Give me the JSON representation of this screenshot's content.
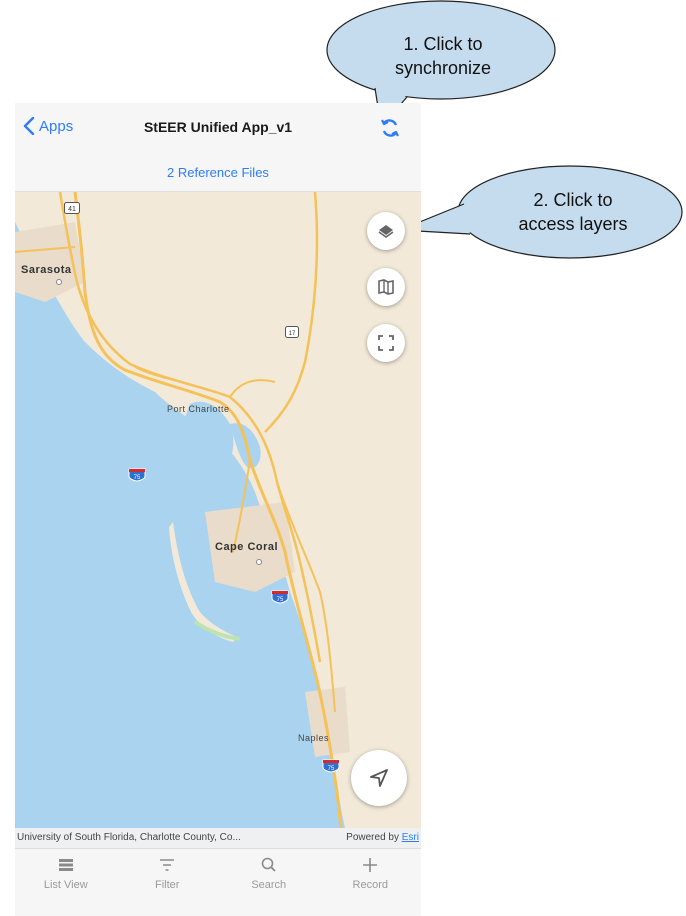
{
  "navbar": {
    "back_label": "Apps",
    "title": "StEER Unified App_v1"
  },
  "reference_files": "2 Reference Files",
  "map": {
    "labels": {
      "sarasota": "Sarasota",
      "port_charlotte": "Port Charlotte",
      "cape_coral": "Cape Coral",
      "naples": "Naples"
    },
    "shields": {
      "us41": "41",
      "i75a": "75",
      "i75b": "75",
      "i75c": "75",
      "fl17": "17"
    }
  },
  "attribution": {
    "source": "University of South Florida, Charlotte County, Co...",
    "powered_by": "Powered by",
    "esri": "Esri"
  },
  "tabs": [
    {
      "label": "List View",
      "icon": "list-icon"
    },
    {
      "label": "Filter",
      "icon": "filter-icon"
    },
    {
      "label": "Search",
      "icon": "search-icon"
    },
    {
      "label": "Record",
      "icon": "plus-icon"
    }
  ],
  "callouts": {
    "sync": {
      "line1": "1. Click to",
      "line2": "synchronize"
    },
    "layers": {
      "line1": "2. Click to",
      "line2": "access layers"
    }
  },
  "colors": {
    "accent": "#2f7cf6",
    "water": "#a9d3ef",
    "land": "#f2e9d8",
    "road": "#f5c159",
    "callout_fill": "#c5dcee"
  }
}
